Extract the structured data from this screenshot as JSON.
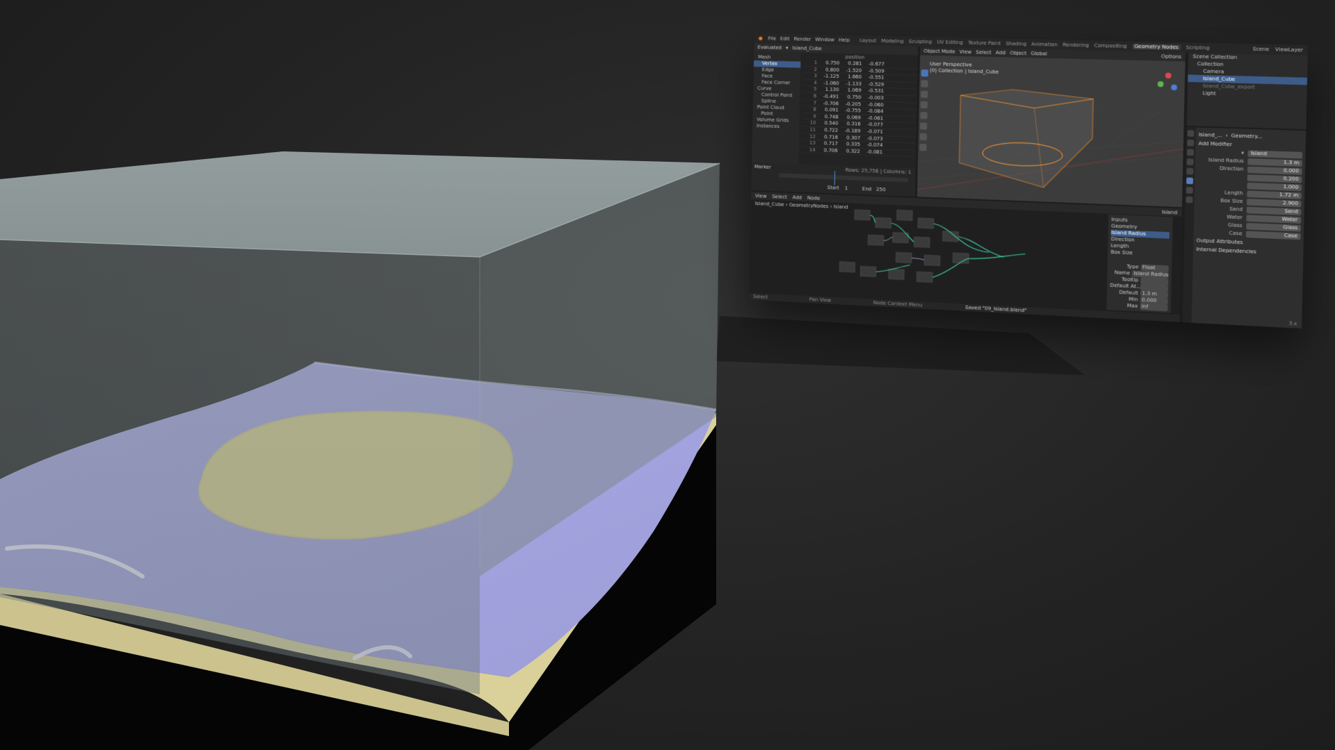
{
  "colors": {
    "background": "#252525",
    "water": "#a6a6e0",
    "sand": "#e0d79b",
    "box_glass": "#8f9a9a",
    "selection_orange": "#ff9a2e",
    "node_link_green": "#3cc3a0",
    "accent_blue": "#4a76b8"
  },
  "blender": {
    "menu": [
      "File",
      "Edit",
      "Render",
      "Window",
      "Help"
    ],
    "workspaces": [
      "Layout",
      "Modeling",
      "Sculpting",
      "UV Editing",
      "Texture Paint",
      "Shading",
      "Animation",
      "Rendering",
      "Compositing",
      "Geometry Nodes",
      "Scripting"
    ],
    "active_workspace": "Geometry Nodes",
    "scene_name": "Scene",
    "view_layer": "ViewLayer",
    "spreadsheet": {
      "toolbar": [
        "Evaluated",
        "Island_Cube"
      ],
      "column_header": "position",
      "outliner": [
        {
          "label": "Mesh",
          "level": 0
        },
        {
          "label": "Vertex",
          "level": 1,
          "selected": true
        },
        {
          "label": "Edge",
          "level": 1
        },
        {
          "label": "Face",
          "level": 1
        },
        {
          "label": "Face Corner",
          "level": 1
        },
        {
          "label": "Curve",
          "level": 0
        },
        {
          "label": "Control Point",
          "level": 1
        },
        {
          "label": "Spline",
          "level": 1
        },
        {
          "label": "Point Cloud",
          "level": 0
        },
        {
          "label": "Point",
          "level": 1
        },
        {
          "label": "Volume Grids",
          "level": 0
        },
        {
          "label": "Instances",
          "level": 0
        }
      ],
      "rows": [
        [
          "1",
          "0.750",
          "0.281",
          "-0.677"
        ],
        [
          "2",
          "0.800",
          "-1.520",
          "-0.509"
        ],
        [
          "3",
          "-1.125",
          "1.660",
          "-0.551"
        ],
        [
          "4",
          "-1.060",
          "-1.133",
          "-0.529"
        ],
        [
          "5",
          "1.130",
          "1.069",
          "-0.531"
        ],
        [
          "6",
          "-0.491",
          "0.750",
          "-0.003"
        ],
        [
          "7",
          "-0.706",
          "-0.205",
          "-0.060"
        ],
        [
          "8",
          "0.091",
          "-0.755",
          "-0.084"
        ],
        [
          "9",
          "0.748",
          "0.069",
          "-0.061"
        ],
        [
          "10",
          "0.540",
          "0.316",
          "-0.077"
        ],
        [
          "11",
          "0.722",
          "-0.189",
          "-0.071"
        ],
        [
          "12",
          "0.716",
          "0.307",
          "-0.073"
        ],
        [
          "13",
          "0.717",
          "0.335",
          "-0.074"
        ],
        [
          "14",
          "0.706",
          "0.322",
          "-0.081"
        ]
      ],
      "status": "Rows: 25,758 | Columns: 1",
      "timeline_labels": [
        "Marker",
        "Start",
        "1",
        "End",
        "250"
      ]
    },
    "viewport": {
      "mode": "Object Mode",
      "menus": [
        "View",
        "Select",
        "Add",
        "Object"
      ],
      "transform": "Global",
      "options": "Options",
      "info_line1": "User Perspective",
      "info_line2": "(0) Collection | Island_Cube"
    },
    "outliner": {
      "title": "Scene Collection",
      "items": [
        {
          "label": "Scene Collection",
          "level": 0
        },
        {
          "label": "Collection",
          "level": 1
        },
        {
          "label": "Camera",
          "level": 2
        },
        {
          "label": "Island_Cube",
          "level": 2,
          "selected": true
        },
        {
          "label": "Island_Cube_export",
          "level": 2,
          "grey": true
        },
        {
          "label": "Light",
          "level": 2
        }
      ]
    },
    "properties": {
      "object": "Island_...",
      "modifier_type": "Geometry...",
      "add_modifier": "Add Modifier",
      "modifier_name": "Island",
      "fields": [
        {
          "label": "Island Radius",
          "value": "1.3 m"
        },
        {
          "label": "Direction",
          "value": "0.000"
        },
        {
          "label": "",
          "value": "0.200"
        },
        {
          "label": "",
          "value": "1.000"
        },
        {
          "label": "Length",
          "value": "1.72 m"
        },
        {
          "label": "Box Size",
          "value": "2.900"
        },
        {
          "label": "Sand",
          "value": "Sand"
        },
        {
          "label": "Water",
          "value": "Water"
        },
        {
          "label": "Glass",
          "value": "Glass"
        },
        {
          "label": "Case",
          "value": "Case"
        }
      ],
      "sections": [
        "Output Attributes",
        "Internal Dependencies"
      ]
    },
    "node_editor": {
      "menus": [
        "View",
        "Select",
        "Add",
        "Node"
      ],
      "node_group": "Island",
      "breadcrumb": [
        "Island_Cube",
        "GeometryNodes",
        "Island"
      ],
      "panel_title": "Inputs",
      "inputs": [
        {
          "label": "Geometry"
        },
        {
          "label": "Island Radius",
          "selected": true
        },
        {
          "label": "Direction"
        },
        {
          "label": "Length"
        },
        {
          "label": "Box Size"
        }
      ],
      "socket": [
        {
          "label": "Type",
          "value": "Float"
        },
        {
          "label": "Name",
          "value": "Island Radius"
        },
        {
          "label": "Tooltip",
          "value": ""
        },
        {
          "label": "Default At...",
          "value": ""
        },
        {
          "label": "Default",
          "value": "1.3 m"
        },
        {
          "label": "Min",
          "value": "0.000"
        },
        {
          "label": "Max",
          "value": "inf"
        }
      ],
      "footer": [
        "Select",
        "Pan View",
        "Node Context Menu"
      ],
      "saved_message": "Saved \"09_Island.blend\"",
      "version": "3.x"
    }
  }
}
